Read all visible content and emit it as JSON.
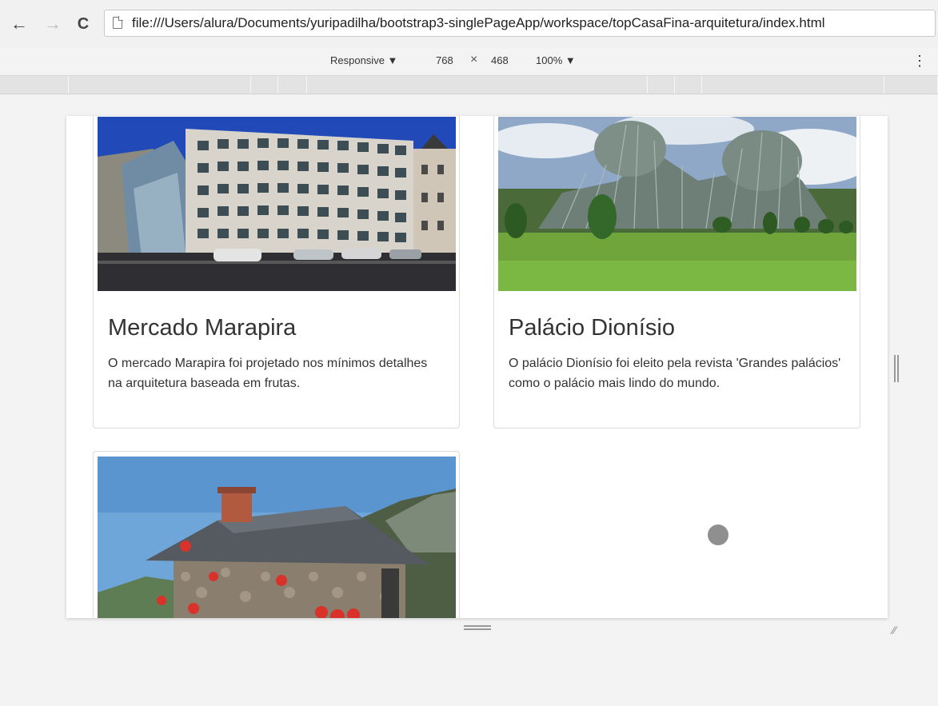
{
  "browser": {
    "url": "file:///Users/alura/Documents/yuripadilha/bootstrap3-singlePageApp/workspace/topCasaFina-arquitetura/index.html",
    "back_glyph": "←",
    "forward_glyph": "→",
    "reload_glyph": "C"
  },
  "device_toolbar": {
    "mode": "Responsive ▼",
    "width": "768",
    "times": "×",
    "height": "468",
    "zoom": "100% ▼",
    "menu_glyph": "⋮"
  },
  "cards": [
    {
      "title": "Mercado Marapira",
      "text": "O mercado Marapira foi projetado nos mínimos detalhes na arquitetura baseada em frutas.",
      "image": "building-photo"
    },
    {
      "title": "Palácio Dionísio",
      "text": "O palácio Dionísio foi eleito pela revista 'Grandes palácios' como o palácio mais lindo do mundo.",
      "image": "palace-greenhouse-photo"
    },
    {
      "image": "stone-house-photo"
    }
  ],
  "colors": {
    "chrome": "#f1f1f1",
    "text": "#333333",
    "card_border": "#dcdcdc"
  }
}
